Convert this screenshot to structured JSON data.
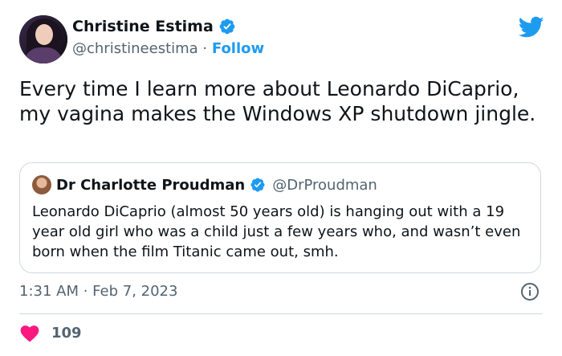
{
  "author": {
    "name": "Christine Estima",
    "handle": "@christineestima",
    "separator": " · ",
    "follow_label": "Follow"
  },
  "tweet": {
    "text": "Every time I learn more about Leonardo DiCaprio, my vagina makes the Windows XP shutdown jingle."
  },
  "quote": {
    "name": "Dr Charlotte Proudman",
    "handle": "@DrProudman",
    "text": "Leonardo DiCaprio (almost 50 years old) is hanging out with a 19 year old girl who was a child just a few years who, and wasn’t even born when the film Titanic came out, smh."
  },
  "meta": {
    "timestamp": "1:31 AM · Feb 7, 2023"
  },
  "stats": {
    "likes": "109"
  },
  "icons": {
    "verified": "verified-badge-icon",
    "twitter": "twitter-bird-icon",
    "info": "info-icon",
    "heart": "heart-icon"
  },
  "colors": {
    "accent": "#1d9bf0",
    "like": "#f91880",
    "secondary_text": "#536471",
    "border": "#cfd9de"
  }
}
